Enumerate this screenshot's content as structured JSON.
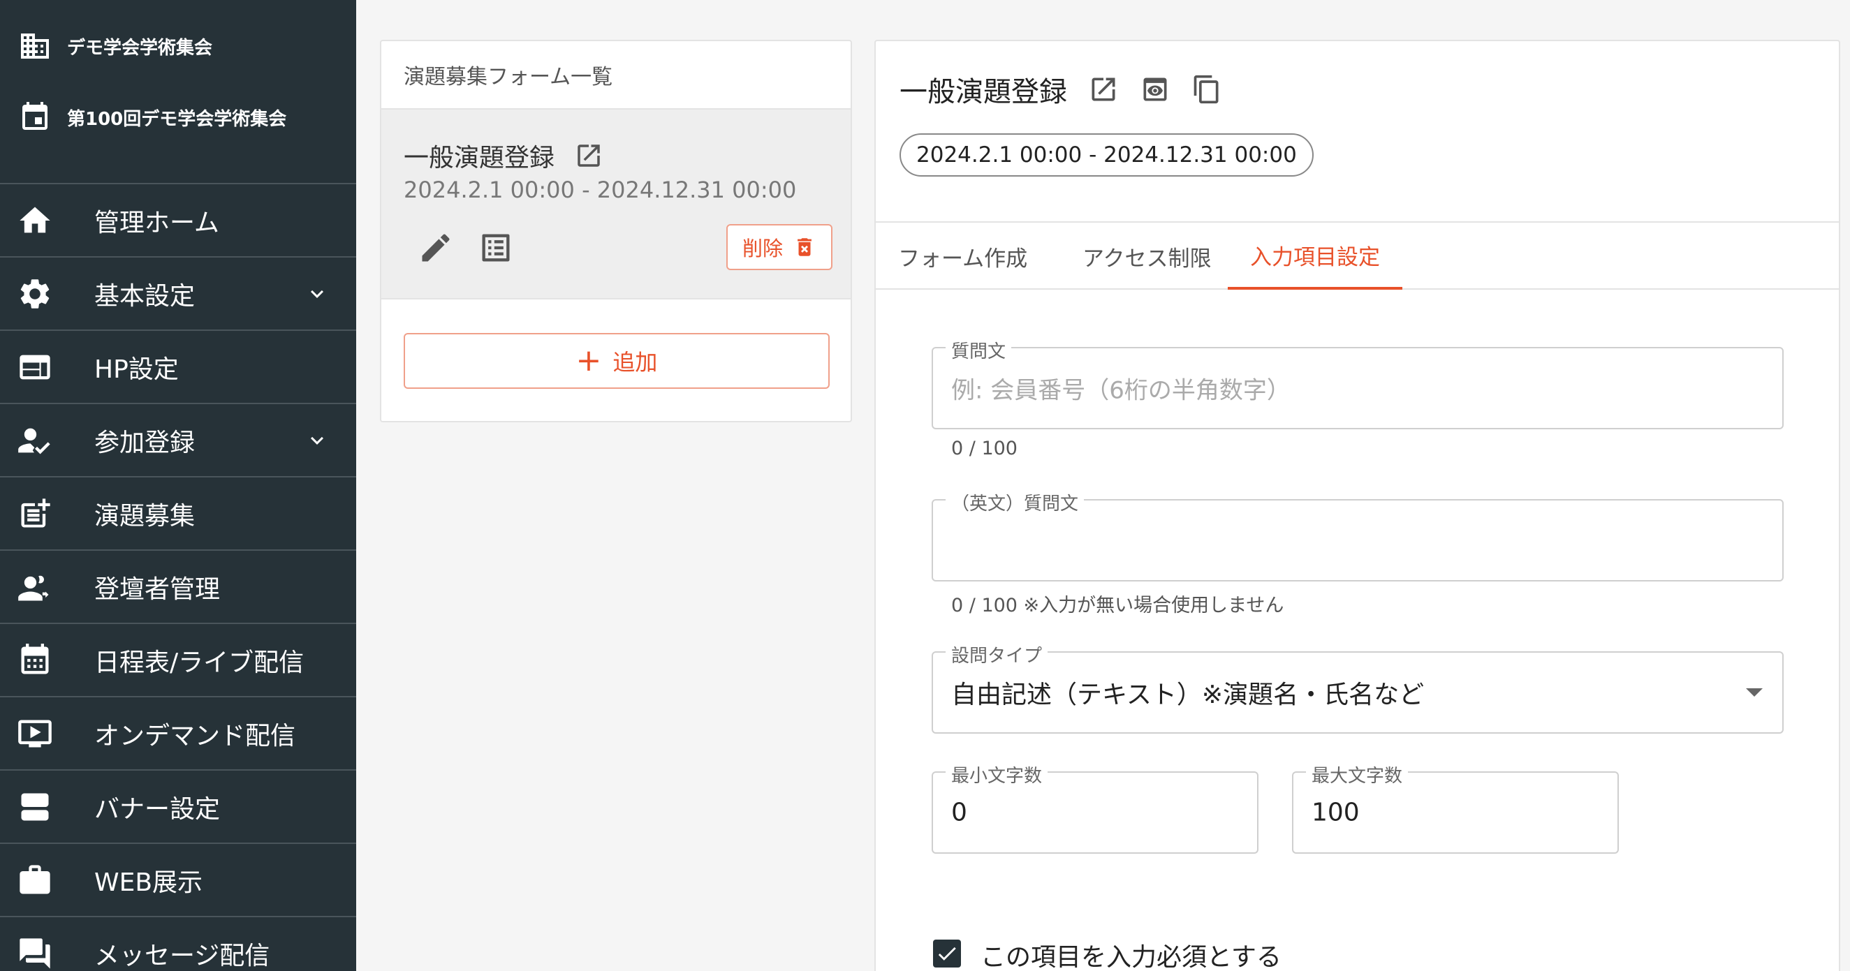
{
  "sidebar": {
    "org_name": "デモ学会学術集会",
    "event_name": "第100回デモ学会学術集会",
    "items": [
      {
        "label": "管理ホーム",
        "icon": "home-icon",
        "expandable": false
      },
      {
        "label": "基本設定",
        "icon": "gear-icon",
        "expandable": true
      },
      {
        "label": "HP設定",
        "icon": "web-layout-icon",
        "expandable": false
      },
      {
        "label": "参加登録",
        "icon": "person-check-icon",
        "expandable": true
      },
      {
        "label": "演題募集",
        "icon": "post-add-icon",
        "expandable": false
      },
      {
        "label": "登壇者管理",
        "icon": "speaker-group-icon",
        "expandable": false
      },
      {
        "label": "日程表/ライブ配信",
        "icon": "calendar-icon",
        "expandable": false
      },
      {
        "label": "オンデマンド配信",
        "icon": "video-play-icon",
        "expandable": false
      },
      {
        "label": "バナー設定",
        "icon": "banner-icon",
        "expandable": false
      },
      {
        "label": "WEB展示",
        "icon": "briefcase-icon",
        "expandable": false
      },
      {
        "label": "メッセージ配信",
        "icon": "chat-icon",
        "expandable": false
      }
    ]
  },
  "form_list": {
    "header": "演題募集フォーム一覧",
    "items": [
      {
        "title": "一般演題登録",
        "period": "2024.2.1 00:00 - 2024.12.31 00:00",
        "delete_label": "削除"
      }
    ],
    "add_label": "追加"
  },
  "detail": {
    "title": "一般演題登録",
    "period": "2024.2.1 00:00 - 2024.12.31 00:00",
    "tabs": [
      "フォーム作成",
      "アクセス制限",
      "入力項目設定"
    ],
    "active_tab": 2,
    "question": {
      "label": "質問文",
      "placeholder": "例: 会員番号（6桁の半角数字）",
      "value": "",
      "helper": "0 / 100"
    },
    "question_en": {
      "label": "（英文）質問文",
      "value": "",
      "helper": "0 / 100 ※入力が無い場合使用しません"
    },
    "question_type": {
      "label": "設問タイプ",
      "value": "自由記述（テキスト）※演題名・氏名など"
    },
    "min_chars": {
      "label": "最小文字数",
      "value": "0"
    },
    "max_chars": {
      "label": "最大文字数",
      "value": "100"
    },
    "required": {
      "label": "この項目を入力必須とする",
      "checked": true
    }
  },
  "colors": {
    "sidebar_bg": "#263238",
    "accent": "#e8512a",
    "page_bg": "#f5f5f5"
  }
}
